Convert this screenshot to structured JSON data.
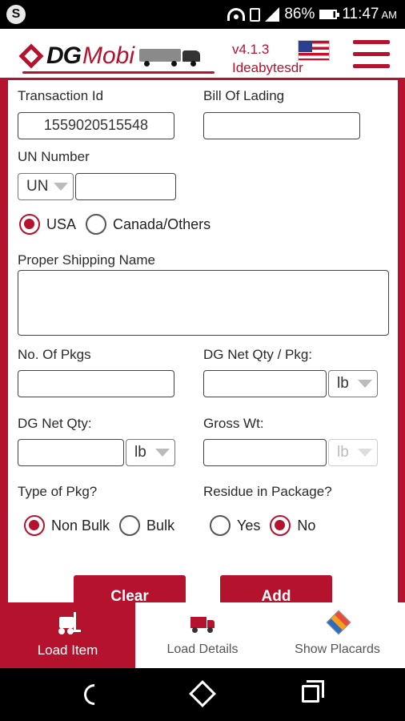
{
  "status_bar": {
    "app_letter": "S",
    "battery": "86%",
    "time": "11:47",
    "ampm": "AM"
  },
  "header": {
    "logo_dg": "DG",
    "logo_mobi": "Mobi",
    "version": "v4.1.3",
    "user": "Ideabytesdr",
    "flag": "us-flag-icon"
  },
  "form": {
    "transaction_id_label": "Transaction Id",
    "transaction_id_value": "1559020515548",
    "bill_of_lading_label": "Bill Of Lading",
    "bill_of_lading_value": "",
    "un_number_label": "UN Number",
    "un_prefix": "UN",
    "un_number_value": "",
    "region_options": [
      "USA",
      "Canada/Others"
    ],
    "region_selected": "USA",
    "proper_shipping_name_label": "Proper Shipping Name",
    "proper_shipping_name_value": "",
    "no_of_pkgs_label": "No. Of Pkgs",
    "no_of_pkgs_value": "",
    "dg_net_qty_pkg_label": "DG Net Qty / Pkg:",
    "dg_net_qty_pkg_unit": "lb",
    "dg_net_qty_label": "DG Net Qty:",
    "dg_net_qty_unit": "lb",
    "gross_wt_label": "Gross Wt:",
    "gross_wt_unit": "lb",
    "type_of_pkg_label": "Type of Pkg?",
    "type_options": [
      "Non Bulk",
      "Bulk"
    ],
    "type_selected": "Non Bulk",
    "residue_label": "Residue in Package?",
    "residue_options": [
      "Yes",
      "No"
    ],
    "residue_selected": "No"
  },
  "buttons": {
    "clear": "Clear",
    "add": "Add"
  },
  "bottom_nav": {
    "tabs": [
      {
        "label": "Load Item",
        "icon": "forklift-icon",
        "active": true
      },
      {
        "label": "Load Details",
        "icon": "truck-icon",
        "active": false
      },
      {
        "label": "Show Placards",
        "icon": "placard-icon",
        "active": false
      }
    ]
  },
  "colors": {
    "brand": "#b5122e"
  }
}
